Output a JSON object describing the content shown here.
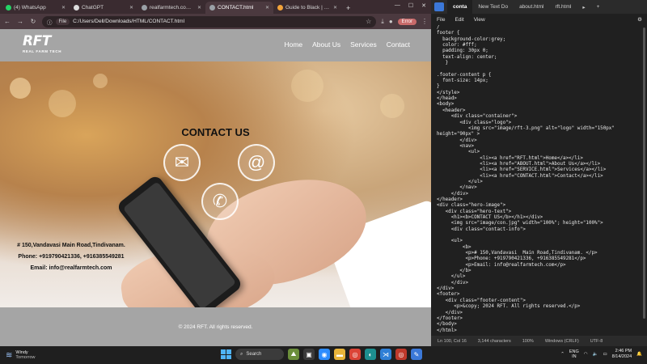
{
  "browser": {
    "tabs": [
      {
        "label": "(4) WhatsApp",
        "color": "#25d366"
      },
      {
        "label": "ChatGPT",
        "color": "#dddddd"
      },
      {
        "label": "realfarmtech.com/SERV",
        "color": "#9aa0a6"
      },
      {
        "label": "CONTACT.html",
        "color": "#9aa0a6"
      },
      {
        "label": "Guide to Black | PicMonk",
        "color": "#f2a33a"
      }
    ],
    "active_tab_index": 3,
    "new_tab": "+",
    "address_chip": "File",
    "address": "C:/Users/Dell/Downloads/HTML/CONTACT.html",
    "error_label": "Error",
    "icons": [
      "back-icon",
      "forward-icon",
      "reload-icon",
      "info-icon",
      "star-icon",
      "download-icon",
      "profile-icon",
      "more-icon"
    ]
  },
  "site": {
    "logo_mark": "RFT",
    "logo_sub": "REAL FARM TECH",
    "nav": [
      "Home",
      "About Us",
      "Services",
      "Contact"
    ],
    "hero_title": "CONTACT US",
    "address_line": "# 150,Vandavasi Main Road,Tindivanam.",
    "phone_line": "Phone: +919790421336, +916385549281",
    "email_line": "Email: info@realfarmtech.com",
    "footer_text": "© 2024 RFT. All rights reserved.",
    "icons": [
      "envelope-icon",
      "at-sign-icon",
      "phone-icon"
    ]
  },
  "editor": {
    "tabs": [
      "conta",
      "New Text Do",
      "about.html",
      "rft.html"
    ],
    "tab_more": "▸",
    "tab_new": "+",
    "menu": [
      "File",
      "Edit",
      "View"
    ],
    "code_lines": [
      "/",
      "footer {",
      "  background-color:grey;",
      "  color: #fff;",
      "  padding: 30px 0;",
      "  text-align: center;",
      "   }",
      "",
      ".footer-content p {",
      "  font-size: 14px;",
      "}",
      "</style>",
      "</head>",
      "<body>",
      "  <header>",
      "     <div class=\"container\">",
      "        <div class=\"logo\">",
      "           <img src=\"image/rft-3.png\" alt=\"logo\" width=\"150px\"",
      "height=\"90px\" >",
      "        </div>",
      "        <nav>",
      "           <ul>",
      "               <li><a href=\"RFT.html\">Home</a></li>",
      "               <li><a href=\"ABOUT.html\">About Us</a></li>",
      "               <li><a href=\"SERVICE.html\">Services</a></li>",
      "               <li><a href=\"CONTACT.html\">Contact</a></li>",
      "           </ul>",
      "        </nav>",
      "     </div>",
      "</header>",
      "<div class=\"hero-image\">",
      "   <div class=\"hero-text\">",
      "     <h1><b>CONTACT US</b></h1></div>",
      "     <img src=\"image/con.jpg\" width=\"100%\"; height=\"100%\">",
      "     <div class=\"contact-info\">",
      "",
      "     <ul>",
      "         <b>",
      "          <p># 150,Vandavasi  Main Road,Tindivanam. </p>",
      "          <p>Phone: +919790421336, +916385549281</p>",
      "          <p>Email: info@realfarmtech.com</p>",
      "        </b>",
      "     </ul>",
      "     </div>",
      "</div>",
      "<footer>",
      "   <div class=\"footer-content\">",
      "      <p>&copy; 2024 RFT. All rights reserved.</p>",
      "   </div>",
      "</footer>",
      "</body>",
      "</html>"
    ],
    "status": {
      "position": "Ln 100, Col 16",
      "chars": "3,144 characters",
      "zoom": "100%",
      "line_endings": "Windows (CRLF)",
      "encoding": "UTF-8"
    }
  },
  "taskbar": {
    "weather_title": "Windy",
    "weather_sub": "Tomorrow",
    "search_label": "Search",
    "lang_top": "ENG",
    "lang_bottom": "IN",
    "time": "2:46 PM",
    "date": "8/14/2024"
  }
}
